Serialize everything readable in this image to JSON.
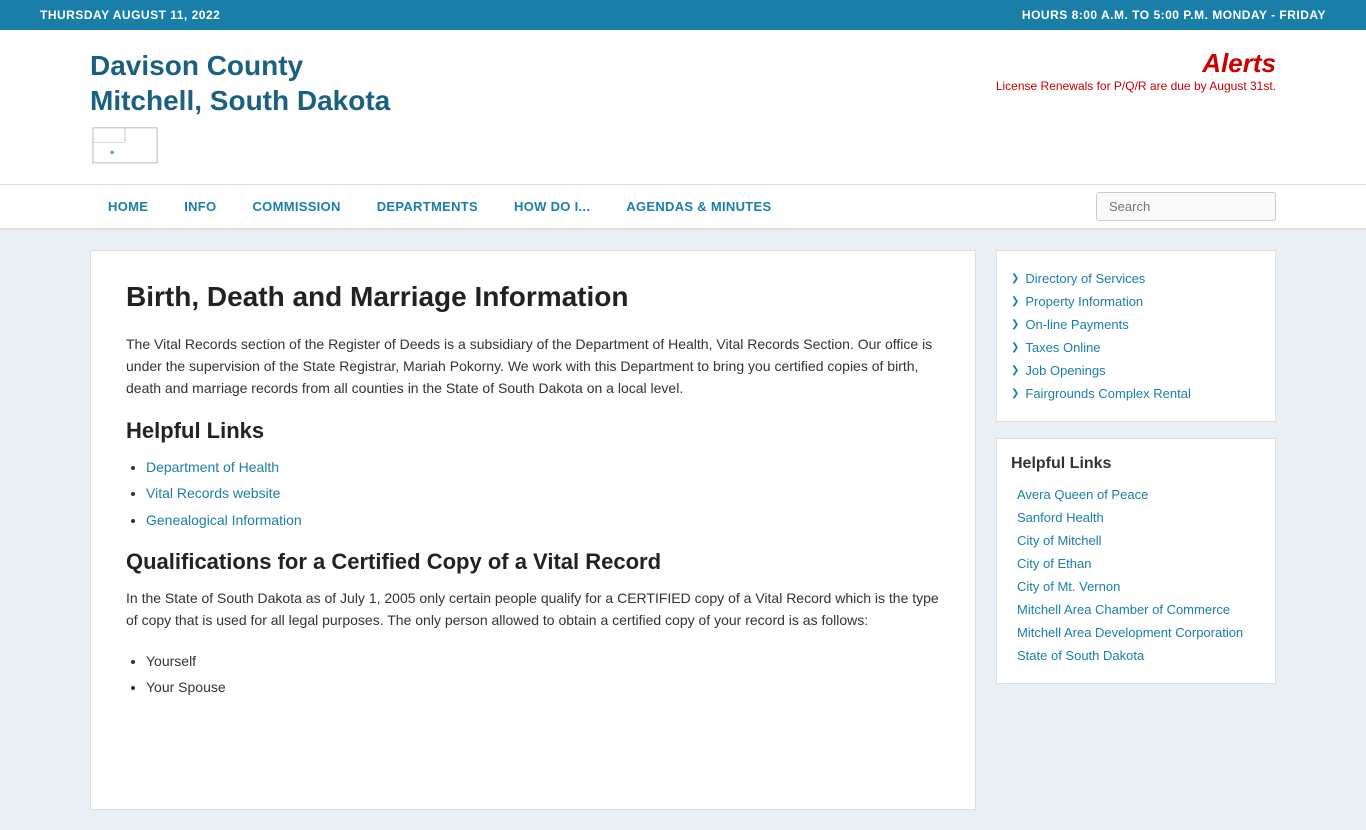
{
  "topbar": {
    "date": "THURSDAY AUGUST 11, 2022",
    "hours": "HOURS 8:00 A.M. TO 5:00 P.M. MONDAY - FRIDAY"
  },
  "header": {
    "title_line1": "Davison County",
    "title_line2": "Mitchell, South Dakota",
    "alerts_title": "Alerts",
    "alerts_text": "License Renewals for P/Q/R are due by August 31st."
  },
  "nav": {
    "items": [
      {
        "label": "HOME"
      },
      {
        "label": "INFO"
      },
      {
        "label": "COMMISSION"
      },
      {
        "label": "DEPARTMENTS"
      },
      {
        "label": "HOW DO I..."
      },
      {
        "label": "AGENDAS & MINUTES"
      }
    ],
    "search_placeholder": "Search"
  },
  "content": {
    "page_title": "Birth, Death and Marriage Information",
    "intro": "The Vital Records section of the Register of Deeds is a subsidiary of the Department of Health, Vital Records Section. Our office is under the supervision of the State Registrar, Mariah Pokorny. We work with this Department to bring you certified copies of birth, death and marriage records from all counties in the State of South Dakota on a local level.",
    "helpful_links_heading": "Helpful Links",
    "links": [
      {
        "label": "Department of Health"
      },
      {
        "label": "Vital Records website"
      },
      {
        "label": "Genealogical Information"
      }
    ],
    "qualifications_heading": "Qualifications for a Certified Copy of a Vital Record",
    "qualifications_text": "In the State of South Dakota as of July 1, 2005 only certain people qualify for a CERTIFIED copy of a Vital Record which is the type of copy that is used for all legal purposes. The only person allowed to obtain a certified copy of your record is as follows:",
    "qualifications_list": [
      "Yourself",
      "Your Spouse"
    ]
  },
  "sidebar": {
    "quick_links": [
      {
        "label": "Directory of Services"
      },
      {
        "label": "Property Information"
      },
      {
        "label": "On-line Payments"
      },
      {
        "label": "Taxes Online"
      },
      {
        "label": "Job Openings"
      },
      {
        "label": "Fairgrounds Complex Rental"
      }
    ],
    "helpful_links_heading": "Helpful Links",
    "helpful_links": [
      {
        "label": "Avera Queen of Peace"
      },
      {
        "label": "Sanford Health"
      },
      {
        "label": "City of Mitchell"
      },
      {
        "label": "City of Ethan"
      },
      {
        "label": "City of Mt. Vernon"
      },
      {
        "label": "Mitchell Area Chamber of Commerce"
      },
      {
        "label": "Mitchell Area Development Corporation"
      },
      {
        "label": "State of South Dakota"
      }
    ]
  }
}
